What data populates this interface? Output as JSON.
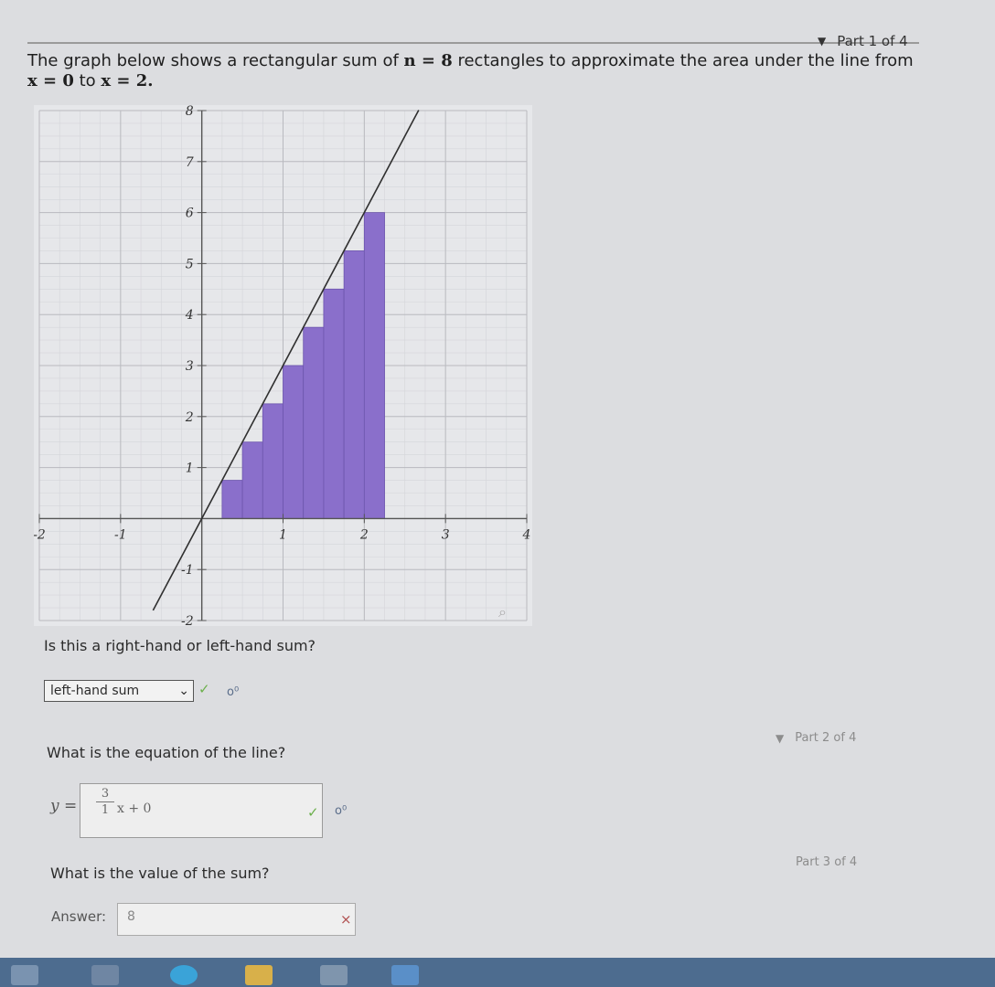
{
  "part1": {
    "label": "Part 1 of 4"
  },
  "prompt": {
    "text_a": "The graph below shows a rectangular sum of ",
    "math_n": "n = 8",
    "text_b": " rectangles to approximate the area under the line from",
    "math_x0": "x = 0",
    "text_c": " to ",
    "math_x2": "x = 2."
  },
  "graph": {
    "x_ticks": [
      "-2",
      "-1",
      "1",
      "2",
      "3",
      "4"
    ],
    "y_ticks": [
      "8",
      "7",
      "6",
      "5",
      "4",
      "3",
      "2",
      "1",
      "-1",
      "-2"
    ],
    "fill_color": "#8a6fcb",
    "line_color": "#2f2f2f"
  },
  "chart_data": {
    "type": "area",
    "function": "y = 3x",
    "x": [
      0,
      2
    ],
    "y": [
      0,
      6
    ],
    "xlim": [
      -2,
      4
    ],
    "ylim": [
      -2,
      8
    ],
    "rectangles": {
      "left_x": [
        0.25,
        0.5,
        0.75,
        1.0,
        1.25,
        1.5,
        1.75,
        2.0
      ],
      "heights": [
        0.75,
        1.5,
        2.25,
        3.0,
        3.75,
        4.5,
        5.25,
        6.0
      ]
    }
  },
  "q1": {
    "question": "Is this a right-hand or left-hand sum?",
    "selected": "left-hand sum",
    "status": "✓"
  },
  "part2": {
    "label": "Part 2 of 4"
  },
  "q2": {
    "question": "What is the equation of the line?",
    "y_label": "y =",
    "numerator": "3",
    "denominator": "1",
    "rest": "x + 0",
    "status": "✓"
  },
  "part3": {
    "label": "Part 3 of 4"
  },
  "q3": {
    "question": "What is the value of the sum?",
    "answer_label": "Answer:",
    "answer_value": "8",
    "status": "×"
  }
}
